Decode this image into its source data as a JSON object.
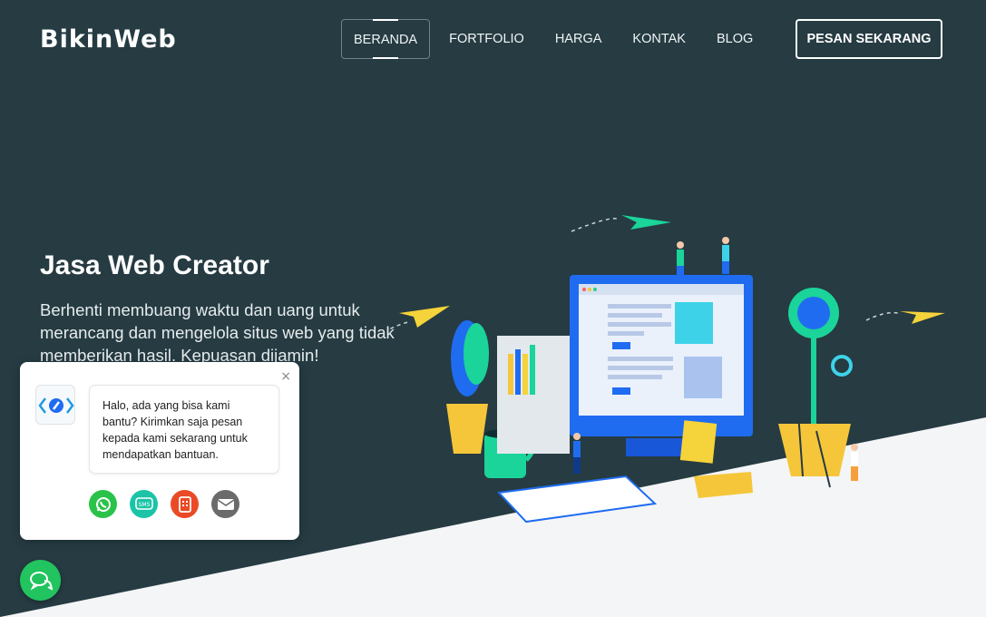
{
  "brand": {
    "logo_text": "BikinWeb"
  },
  "nav": {
    "items": [
      {
        "label": "BERANDA",
        "active": true
      },
      {
        "label": "FORTFOLIO",
        "active": false
      },
      {
        "label": "HARGA",
        "active": false
      },
      {
        "label": "KONTAK",
        "active": false
      },
      {
        "label": "BLOG",
        "active": false
      }
    ],
    "cta_label": "PESAN SEKARANG"
  },
  "hero": {
    "title": "Jasa Web Creator",
    "subtitle": "Berhenti membuang waktu dan uang untuk merancang dan mengelola situs web yang tidak memberikan hasil. Kepuasan dijamin!"
  },
  "chat_widget": {
    "message": "Halo, ada yang bisa kami bantu? Kirimkan saja pesan kepada kami sekarang untuk mendapatkan bantuan.",
    "close_glyph": "×",
    "actions": [
      {
        "icon": "whatsapp-icon",
        "color": "#2ac34a"
      },
      {
        "icon": "sms-icon",
        "label": "SMS",
        "color": "#1bc4a7"
      },
      {
        "icon": "phone-icon",
        "color": "#ea4a26"
      },
      {
        "icon": "email-icon",
        "color": "#6b6b6b"
      }
    ],
    "fab_icon": "chat-icon",
    "fab_color": "#21c45e"
  },
  "colors": {
    "background": "#263b42",
    "diagonal": "#f4f5f7",
    "accent_blue": "#1f6cf0",
    "accent_green": "#1bd49a"
  }
}
